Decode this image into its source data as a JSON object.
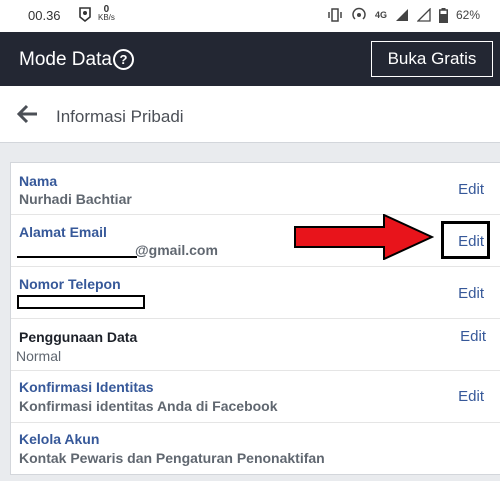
{
  "status": {
    "time": "00.36",
    "speed_value": "0",
    "speed_unit": "KB/s",
    "network": "4G",
    "battery": "62%"
  },
  "topbar": {
    "title": "Mode Data",
    "help_icon": "?",
    "free_button": "Buka Gratis"
  },
  "header": {
    "title": "Informasi Pribadi"
  },
  "rows": [
    {
      "title": "Nama",
      "subtitle": "Nurhadi Bachtiar",
      "action": "Edit"
    },
    {
      "title": "Alamat Email",
      "subtitle": "@gmail.com",
      "action": "Edit"
    },
    {
      "title": "Nomor Telepon",
      "subtitle": "",
      "action": "Edit"
    },
    {
      "title": "Penggunaan Data",
      "subtitle": "Normal",
      "action": "Edit"
    },
    {
      "title": "Konfirmasi Identitas",
      "subtitle": "Konfirmasi identitas Anda di Facebook",
      "action": "Edit"
    },
    {
      "title": "Kelola Akun",
      "subtitle": "Kontak Pewaris dan Pengaturan Penonaktifan",
      "action": ""
    }
  ],
  "annotation": {
    "arrow_color": "#e8141b"
  }
}
